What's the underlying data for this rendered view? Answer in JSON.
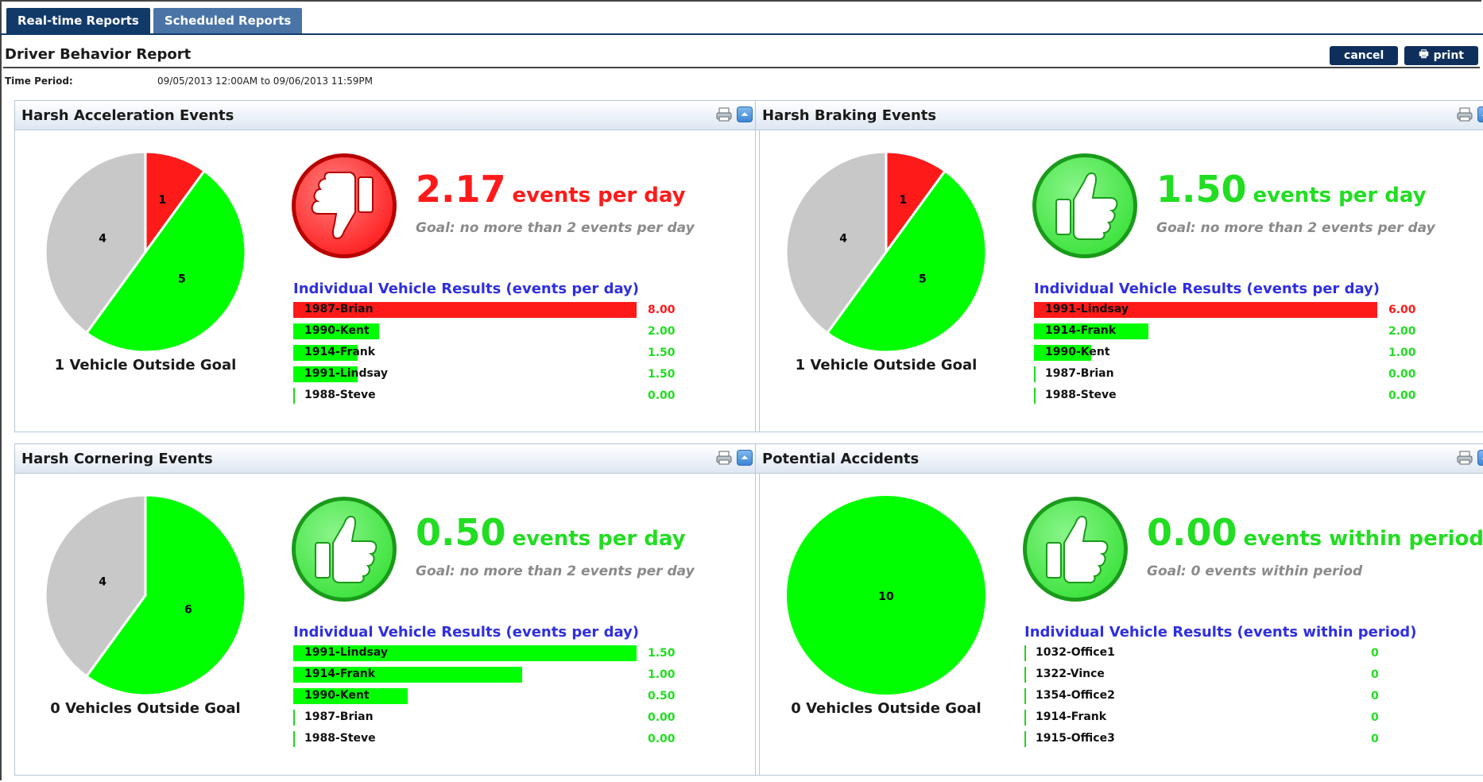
{
  "tabs": [
    "Real-time Reports",
    "Scheduled Reports"
  ],
  "report_title": "Driver Behavior Report",
  "buttons": {
    "cancel": "cancel",
    "print": "print"
  },
  "time_period": {
    "label": "Time Period:",
    "value": "09/05/2013 12:00AM to 09/06/2013 11:59PM"
  },
  "colors": {
    "red": "#ff1a1a",
    "green": "#00ff00",
    "gray": "#c8c8c8",
    "good_text": "#22dd22",
    "bad_text": "#ff1a1a"
  },
  "panels": [
    {
      "title": "Harsh Acceleration Events",
      "status": "bad",
      "pie": [
        {
          "value": 1,
          "color": "red"
        },
        {
          "value": 5,
          "color": "green"
        },
        {
          "value": 4,
          "color": "gray"
        }
      ],
      "pie_label": "1 Vehicle Outside Goal",
      "big_number": "2.17",
      "unit": "events per day",
      "goal": "Goal: no more than 2 events per day",
      "results_heading": "Individual Vehicle Results (events per day)",
      "results": [
        {
          "name": "1987-Brian",
          "value": "8.00",
          "level": 1.0,
          "color": "red"
        },
        {
          "name": "1990-Kent",
          "value": "2.00",
          "level": 0.25,
          "color": "green"
        },
        {
          "name": "1914-Frank",
          "value": "1.50",
          "level": 0.1875,
          "color": "green"
        },
        {
          "name": "1991-Lindsay",
          "value": "1.50",
          "level": 0.1875,
          "color": "green"
        },
        {
          "name": "1988-Steve",
          "value": "0.00",
          "level": 0,
          "color": "green"
        }
      ]
    },
    {
      "title": "Harsh Braking Events",
      "status": "good",
      "pie": [
        {
          "value": 1,
          "color": "red"
        },
        {
          "value": 5,
          "color": "green"
        },
        {
          "value": 4,
          "color": "gray"
        }
      ],
      "pie_label": "1 Vehicle Outside Goal",
      "big_number": "1.50",
      "unit": "events per day",
      "goal": "Goal: no more than 2 events per day",
      "results_heading": "Individual Vehicle Results (events per day)",
      "results": [
        {
          "name": "1991-Lindsay",
          "value": "6.00",
          "level": 1.0,
          "color": "red"
        },
        {
          "name": "1914-Frank",
          "value": "2.00",
          "level": 0.3333,
          "color": "green"
        },
        {
          "name": "1990-Kent",
          "value": "1.00",
          "level": 0.1667,
          "color": "green"
        },
        {
          "name": "1987-Brian",
          "value": "0.00",
          "level": 0,
          "color": "green"
        },
        {
          "name": "1988-Steve",
          "value": "0.00",
          "level": 0,
          "color": "green"
        }
      ]
    },
    {
      "title": "Harsh Cornering Events",
      "status": "good",
      "pie": [
        {
          "value": 6,
          "color": "green"
        },
        {
          "value": 4,
          "color": "gray"
        }
      ],
      "pie_label": "0 Vehicles Outside Goal",
      "big_number": "0.50",
      "unit": "events per day",
      "goal": "Goal: no more than 2 events per day",
      "results_heading": "Individual Vehicle Results (events per day)",
      "results": [
        {
          "name": "1991-Lindsay",
          "value": "1.50",
          "level": 1.0,
          "color": "green"
        },
        {
          "name": "1914-Frank",
          "value": "1.00",
          "level": 0.6667,
          "color": "green"
        },
        {
          "name": "1990-Kent",
          "value": "0.50",
          "level": 0.3333,
          "color": "green"
        },
        {
          "name": "1987-Brian",
          "value": "0.00",
          "level": 0,
          "color": "green"
        },
        {
          "name": "1988-Steve",
          "value": "0.00",
          "level": 0,
          "color": "green"
        }
      ]
    },
    {
      "title": "Potential Accidents",
      "status": "good",
      "pie": [
        {
          "value": 10,
          "color": "green"
        }
      ],
      "pie_label": "0 Vehicles Outside Goal",
      "big_number": "0.00",
      "unit": "events within period",
      "goal": "Goal: 0 events within period",
      "results_heading": "Individual Vehicle Results (events within period)",
      "results": [
        {
          "name": "1032-Office1",
          "value": "0",
          "level": 0,
          "color": "green"
        },
        {
          "name": "1322-Vince",
          "value": "0",
          "level": 0,
          "color": "green"
        },
        {
          "name": "1354-Office2",
          "value": "0",
          "level": 0,
          "color": "green"
        },
        {
          "name": "1914-Frank",
          "value": "0",
          "level": 0,
          "color": "green"
        },
        {
          "name": "1915-Office3",
          "value": "0",
          "level": 0,
          "color": "green"
        }
      ]
    }
  ]
}
